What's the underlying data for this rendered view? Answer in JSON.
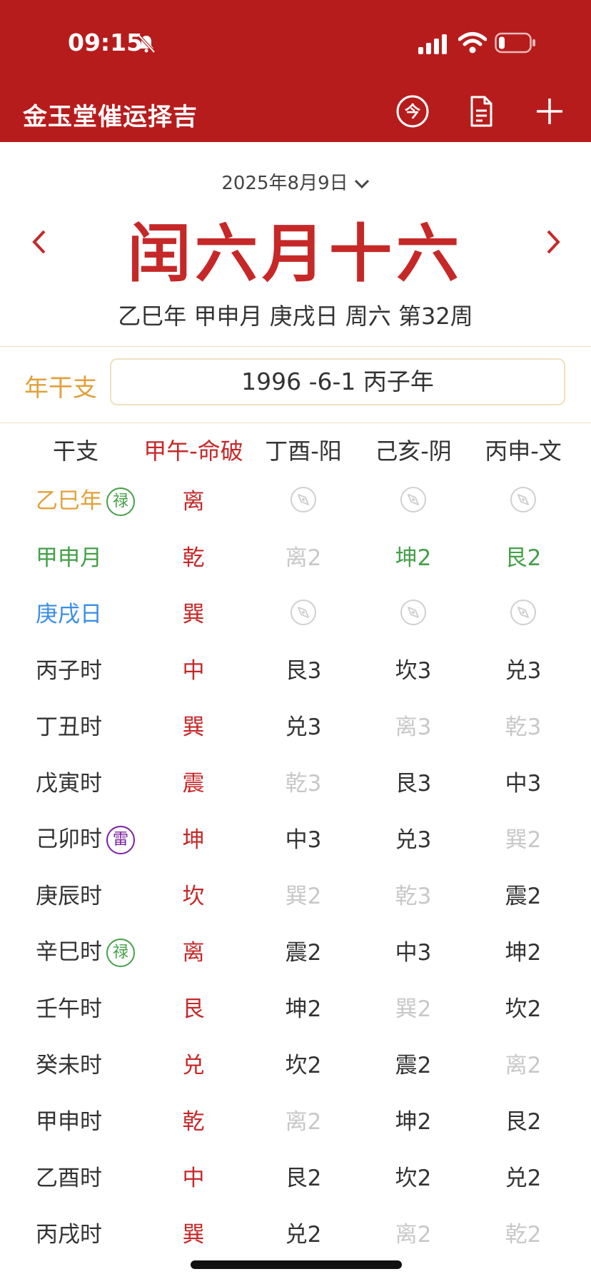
{
  "status_bar": {
    "time": "09:15"
  },
  "app_bar": {
    "title": "金玉堂催运择吉",
    "today_icon_text": "今"
  },
  "date": {
    "solar": "2025年8月9日",
    "lunar": "闰六月十六",
    "ganzhi_line": "乙巳年 甲申月 庚戌日 周六 第32周"
  },
  "year_ganzhi": {
    "label": "年干支",
    "value": "1996 -6-1 丙子年"
  },
  "table": {
    "headers": [
      "干支",
      "甲午-命破",
      "丁酉-阳",
      "己亥-阴",
      "丙申-文"
    ],
    "rows": [
      {
        "label": "乙巳年",
        "label_color": "orange",
        "badge": "禄",
        "badge_type": "lu",
        "trigram": "离",
        "cells": [
          {
            "t": "",
            "s": "compass"
          },
          {
            "t": "",
            "s": "compass"
          },
          {
            "t": "",
            "s": "compass"
          }
        ]
      },
      {
        "label": "甲申月",
        "label_color": "green",
        "badge": "",
        "badge_type": "",
        "trigram": "乾",
        "cells": [
          {
            "t": "离2",
            "s": "faded"
          },
          {
            "t": "坤2",
            "s": "green"
          },
          {
            "t": "艮2",
            "s": "green"
          }
        ]
      },
      {
        "label": "庚戌日",
        "label_color": "blue",
        "badge": "",
        "badge_type": "",
        "trigram": "巽",
        "cells": [
          {
            "t": "",
            "s": "compass"
          },
          {
            "t": "",
            "s": "compass"
          },
          {
            "t": "",
            "s": "compass"
          }
        ]
      },
      {
        "label": "丙子时",
        "label_color": "",
        "badge": "",
        "badge_type": "",
        "trigram": "中",
        "cells": [
          {
            "t": "艮3",
            "s": "normal"
          },
          {
            "t": "坎3",
            "s": "normal"
          },
          {
            "t": "兑3",
            "s": "normal"
          }
        ]
      },
      {
        "label": "丁丑时",
        "label_color": "",
        "badge": "",
        "badge_type": "",
        "trigram": "巽",
        "cells": [
          {
            "t": "兑3",
            "s": "normal"
          },
          {
            "t": "离3",
            "s": "faded"
          },
          {
            "t": "乾3",
            "s": "faded"
          }
        ]
      },
      {
        "label": "戊寅时",
        "label_color": "",
        "badge": "",
        "badge_type": "",
        "trigram": "震",
        "cells": [
          {
            "t": "乾3",
            "s": "faded"
          },
          {
            "t": "艮3",
            "s": "normal"
          },
          {
            "t": "中3",
            "s": "normal"
          }
        ]
      },
      {
        "label": "己卯时",
        "label_color": "",
        "badge": "雷",
        "badge_type": "lei",
        "trigram": "坤",
        "cells": [
          {
            "t": "中3",
            "s": "normal"
          },
          {
            "t": "兑3",
            "s": "normal"
          },
          {
            "t": "巽2",
            "s": "faded"
          }
        ]
      },
      {
        "label": "庚辰时",
        "label_color": "",
        "badge": "",
        "badge_type": "",
        "trigram": "坎",
        "cells": [
          {
            "t": "巽2",
            "s": "faded"
          },
          {
            "t": "乾3",
            "s": "faded"
          },
          {
            "t": "震2",
            "s": "normal"
          }
        ]
      },
      {
        "label": "辛巳时",
        "label_color": "",
        "badge": "禄",
        "badge_type": "lu",
        "trigram": "离",
        "cells": [
          {
            "t": "震2",
            "s": "normal"
          },
          {
            "t": "中3",
            "s": "normal"
          },
          {
            "t": "坤2",
            "s": "normal"
          }
        ]
      },
      {
        "label": "壬午时",
        "label_color": "",
        "badge": "",
        "badge_type": "",
        "trigram": "艮",
        "cells": [
          {
            "t": "坤2",
            "s": "normal"
          },
          {
            "t": "巽2",
            "s": "faded"
          },
          {
            "t": "坎2",
            "s": "normal"
          }
        ]
      },
      {
        "label": "癸未时",
        "label_color": "",
        "badge": "",
        "badge_type": "",
        "trigram": "兑",
        "cells": [
          {
            "t": "坎2",
            "s": "normal"
          },
          {
            "t": "震2",
            "s": "normal"
          },
          {
            "t": "离2",
            "s": "faded"
          }
        ]
      },
      {
        "label": "甲申时",
        "label_color": "",
        "badge": "",
        "badge_type": "",
        "trigram": "乾",
        "cells": [
          {
            "t": "离2",
            "s": "faded"
          },
          {
            "t": "坤2",
            "s": "normal"
          },
          {
            "t": "艮2",
            "s": "normal"
          }
        ]
      },
      {
        "label": "乙酉时",
        "label_color": "",
        "badge": "",
        "badge_type": "",
        "trigram": "中",
        "cells": [
          {
            "t": "艮2",
            "s": "normal"
          },
          {
            "t": "坎2",
            "s": "normal"
          },
          {
            "t": "兑2",
            "s": "normal"
          }
        ]
      },
      {
        "label": "丙戌时",
        "label_color": "",
        "badge": "",
        "badge_type": "",
        "trigram": "巽",
        "cells": [
          {
            "t": "兑2",
            "s": "normal"
          },
          {
            "t": "离2",
            "s": "faded"
          },
          {
            "t": "乾2",
            "s": "faded"
          }
        ]
      }
    ]
  },
  "colors": {
    "brand_red": "#b71c1c",
    "accent_red": "#c62828",
    "orange": "#e2a03a",
    "green": "#43a047",
    "blue": "#3a8ee6",
    "purple": "#7b1fa2",
    "faded": "#c8c8c8"
  }
}
